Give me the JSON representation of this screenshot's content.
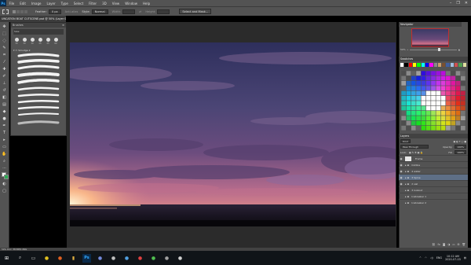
{
  "menubar": {
    "logo": "Ps",
    "items": [
      "File",
      "Edit",
      "Image",
      "Layer",
      "Type",
      "Select",
      "Filter",
      "3D",
      "View",
      "Window",
      "Help"
    ],
    "window_controls": [
      "–",
      "❐",
      "✕"
    ]
  },
  "options": {
    "feather_label": "Feather:",
    "feather_value": "0 px",
    "antialias_label": "Anti-alias",
    "style_label": "Style:",
    "style_value": "Normal",
    "width_label": "Width:",
    "height_label": "Height:",
    "select_mask_button": "Select and Mask..."
  },
  "document": {
    "tab_title": "UNCATION BOAT CUTSCENE.psd @ 50% (Layer 0, RGB/8)"
  },
  "brushes": {
    "title": "Brushes",
    "size_label": "Size:",
    "presets": [
      {
        "label": "30"
      },
      {
        "label": "30"
      },
      {
        "label": "30"
      },
      {
        "label": "25"
      },
      {
        "label": "25"
      },
      {
        "label": "60"
      }
    ],
    "folder_label": "Smudge 2"
  },
  "navigator": {
    "title": "Navigator",
    "zoom": "50%"
  },
  "swatches": {
    "title": "Swatches",
    "top_colors": [
      "#ffffff",
      "#000000",
      "#ff0000",
      "#ffff00",
      "#00ff00",
      "#00ffff",
      "#0000ff",
      "#ff00ff",
      "#888888",
      "#c8a070",
      "#7a5030",
      "#4060a0",
      "#a0c0e0",
      "#d05050",
      "#50a050",
      "#e0e0a0"
    ]
  },
  "layers": {
    "title": "Layers",
    "kind_label": "Kind",
    "blend_mode": "Pass Through",
    "opacity_label": "Opacity:",
    "opacity_value": "100%",
    "lock_label": "Lock:",
    "fill_label": "Fill:",
    "fill_value": "100%",
    "items": [
      {
        "name": "Frame",
        "thumb": "#e8e8e8",
        "visible": true,
        "active": false,
        "folder": false
      },
      {
        "name": "Outline",
        "thumb": "#4a4a4a",
        "visible": true,
        "active": false,
        "folder": true
      },
      {
        "name": "4 water",
        "thumb": "#4a4a4a",
        "visible": true,
        "active": false,
        "folder": true
      },
      {
        "name": "3 Spine",
        "thumb": "#4a4a4a",
        "visible": true,
        "active": true,
        "folder": true
      },
      {
        "name": "2 sail",
        "thumb": "#4a4a4a",
        "visible": true,
        "active": false,
        "folder": true
      },
      {
        "name": "3 lookout",
        "thumb": "#4a4a4a",
        "visible": false,
        "active": false,
        "folder": true
      },
      {
        "name": "Icebreaker 1",
        "thumb": "#4a4a4a",
        "visible": false,
        "active": false,
        "folder": true
      },
      {
        "name": "Icebreaker 2",
        "thumb": "#4a4a4a",
        "visible": false,
        "active": false,
        "folder": true
      }
    ]
  },
  "status": {
    "text": "50%    Doc: 38.8M/1.84G"
  },
  "taskbar": {
    "icons": [
      {
        "name": "windows-start-icon",
        "glyph": "⊞",
        "color": "#ffffff"
      },
      {
        "name": "search-icon",
        "glyph": "⌕",
        "color": "#cccccc"
      },
      {
        "name": "task-view-icon",
        "glyph": "▭",
        "color": "#cccccc"
      },
      {
        "name": "chrome-icon",
        "glyph": "●",
        "color": "#e0c020"
      },
      {
        "name": "firefox-icon",
        "glyph": "●",
        "color": "#e06020"
      },
      {
        "name": "explorer-icon",
        "glyph": "▮",
        "color": "#e0b040"
      },
      {
        "name": "photoshop-icon",
        "glyph": "Ps",
        "color": "#31a8ff"
      },
      {
        "name": "discord-icon",
        "glyph": "●",
        "color": "#7289da"
      },
      {
        "name": "steam-icon",
        "glyph": "●",
        "color": "#c0c0c0"
      },
      {
        "name": "app-icon-1",
        "glyph": "●",
        "color": "#50a0e0"
      },
      {
        "name": "app-icon-2",
        "glyph": "●",
        "color": "#e04040"
      },
      {
        "name": "app-icon-3",
        "glyph": "●",
        "color": "#50c050"
      },
      {
        "name": "app-icon-4",
        "glyph": "●",
        "color": "#a0a0a0"
      },
      {
        "name": "app-icon-5",
        "glyph": "●",
        "color": "#d0d0d0"
      }
    ],
    "tray_lang": "ENG",
    "time": "10:12 AM",
    "date": "2020-07-03"
  }
}
